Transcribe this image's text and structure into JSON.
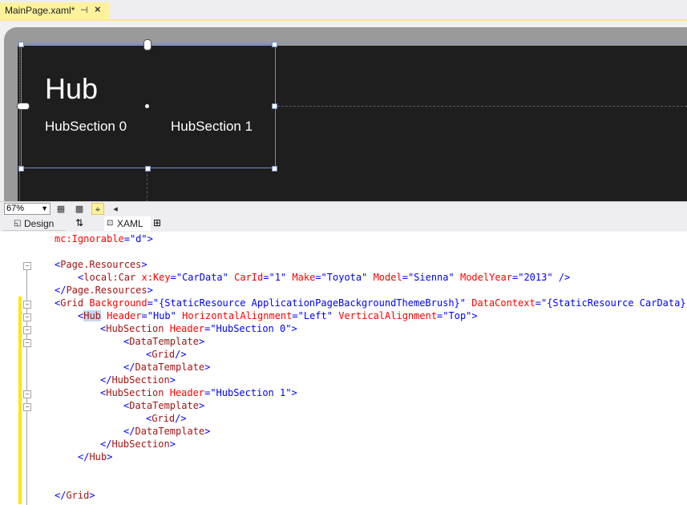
{
  "tab": {
    "title": "MainPage.xaml*",
    "pin": "⊣",
    "close": "×"
  },
  "designer": {
    "hub_header": "Hub",
    "sections": [
      "HubSection 0",
      "HubSection 1"
    ]
  },
  "zoom": {
    "value": "67%"
  },
  "split": {
    "design": "Design",
    "xaml": "XAML"
  },
  "code": {
    "l1_attr": "mc:Ignorable",
    "l1_eq": "=",
    "l1_val": "\"d\"",
    "l1_close": ">",
    "l2_open": "<",
    "l2_tag": "Page.Resources",
    "l2_close": ">",
    "l3_open": "<",
    "l3_tag": "local:Car",
    "l3_a1": "x:Key",
    "l3_v1": "\"CarData\"",
    "l3_a2": "CarId",
    "l3_v2": "\"1\"",
    "l3_a3": "Make",
    "l3_v3": "\"Toyota\"",
    "l3_a4": "Model",
    "l3_v4": "\"Sienna\"",
    "l3_a5": "ModelYear",
    "l3_v5": "\"2013\"",
    "l3_close": " />",
    "l4_open": "</",
    "l4_tag": "Page.Resources",
    "l4_close": ">",
    "l5_open": "<",
    "l5_tag": "Grid",
    "l5_a1": "Background",
    "l5_v1": "\"{StaticResource ApplicationPageBackgroundThemeBrush}\"",
    "l5_a2": "DataContext",
    "l5_v2": "\"{StaticResource CarData}\"",
    "l5_close": " >",
    "l6_open": "<",
    "l6_tag": "Hub",
    "l6_a1": "Header",
    "l6_v1": "\"Hub\"",
    "l6_a2": "HorizontalAlignment",
    "l6_v2": "\"Left\"",
    "l6_a3": "VerticalAlignment",
    "l6_v3": "\"Top\"",
    "l6_close": ">",
    "l7_open": "<",
    "l7_tag": "HubSection",
    "l7_a1": "Header",
    "l7_v1": "\"HubSection 0\"",
    "l7_close": ">",
    "l8_open": "<",
    "l8_tag": "DataTemplate",
    "l8_close": ">",
    "l9_open": "<",
    "l9_tag": "Grid",
    "l9_close": "/>",
    "l10_open": "</",
    "l10_tag": "DataTemplate",
    "l10_close": ">",
    "l11_open": "</",
    "l11_tag": "HubSection",
    "l11_close": ">",
    "l12_open": "<",
    "l12_tag": "HubSection",
    "l12_a1": "Header",
    "l12_v1": "\"HubSection 1\"",
    "l12_close": ">",
    "l13_open": "<",
    "l13_tag": "DataTemplate",
    "l13_close": ">",
    "l14_open": "<",
    "l14_tag": "Grid",
    "l14_close": "/>",
    "l15_open": "</",
    "l15_tag": "DataTemplate",
    "l15_close": ">",
    "l16_open": "</",
    "l16_tag": "HubSection",
    "l16_close": ">",
    "l17_open": "</",
    "l17_tag": "Hub",
    "l17_close": ">",
    "l18_open": "</",
    "l18_tag": "Grid",
    "l18_close": ">"
  }
}
